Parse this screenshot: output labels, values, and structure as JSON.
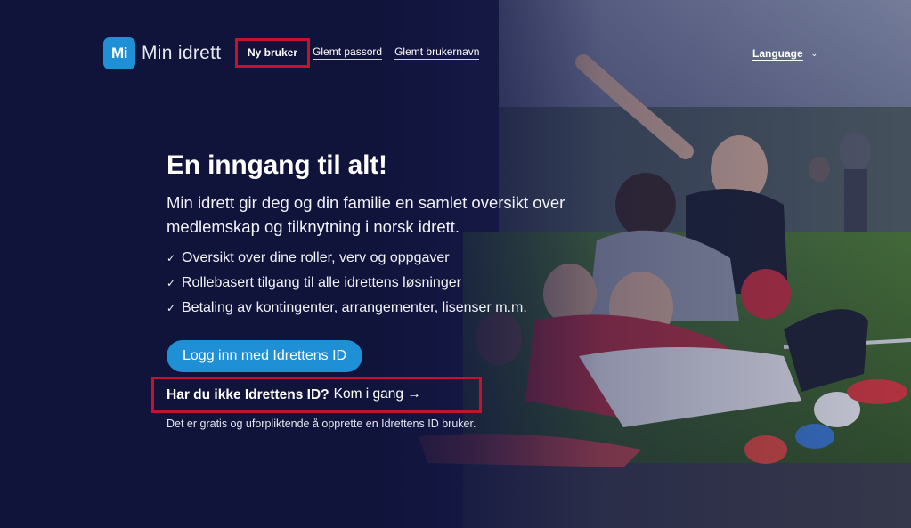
{
  "header": {
    "logo_badge": "Mi",
    "logo_text": "Min idrett",
    "nav": {
      "new_user": "Ny bruker",
      "forgot_password": "Glemt passord",
      "forgot_username": "Glemt brukernavn"
    },
    "language_label": "Language",
    "language_icon": "chevron-down-icon"
  },
  "main": {
    "title": "En inngang til alt!",
    "lead": "Min idrett gir deg og din familie en samlet oversikt over medlemskap og tilknytning i norsk idrett.",
    "check_glyph": "✓",
    "features": [
      "Oversikt over dine roller, verv og oppgaver",
      "Rollebasert tilgang til alle idrettens løsninger",
      "Betaling av kontingenter, arrangementer, lisenser m.m."
    ],
    "login_button": "Logg inn med Idrettens ID",
    "signup_question": "Har du ikke Idrettens ID?",
    "signup_link": "Kom i gang →",
    "fineprint": "Det er gratis og uforpliktende å opprette en Idrettens ID bruker."
  },
  "colors": {
    "background": "#111438",
    "accent_blue": "#1f8fd6",
    "highlight_red": "#c4122f",
    "grass": "#3f6b2e"
  }
}
